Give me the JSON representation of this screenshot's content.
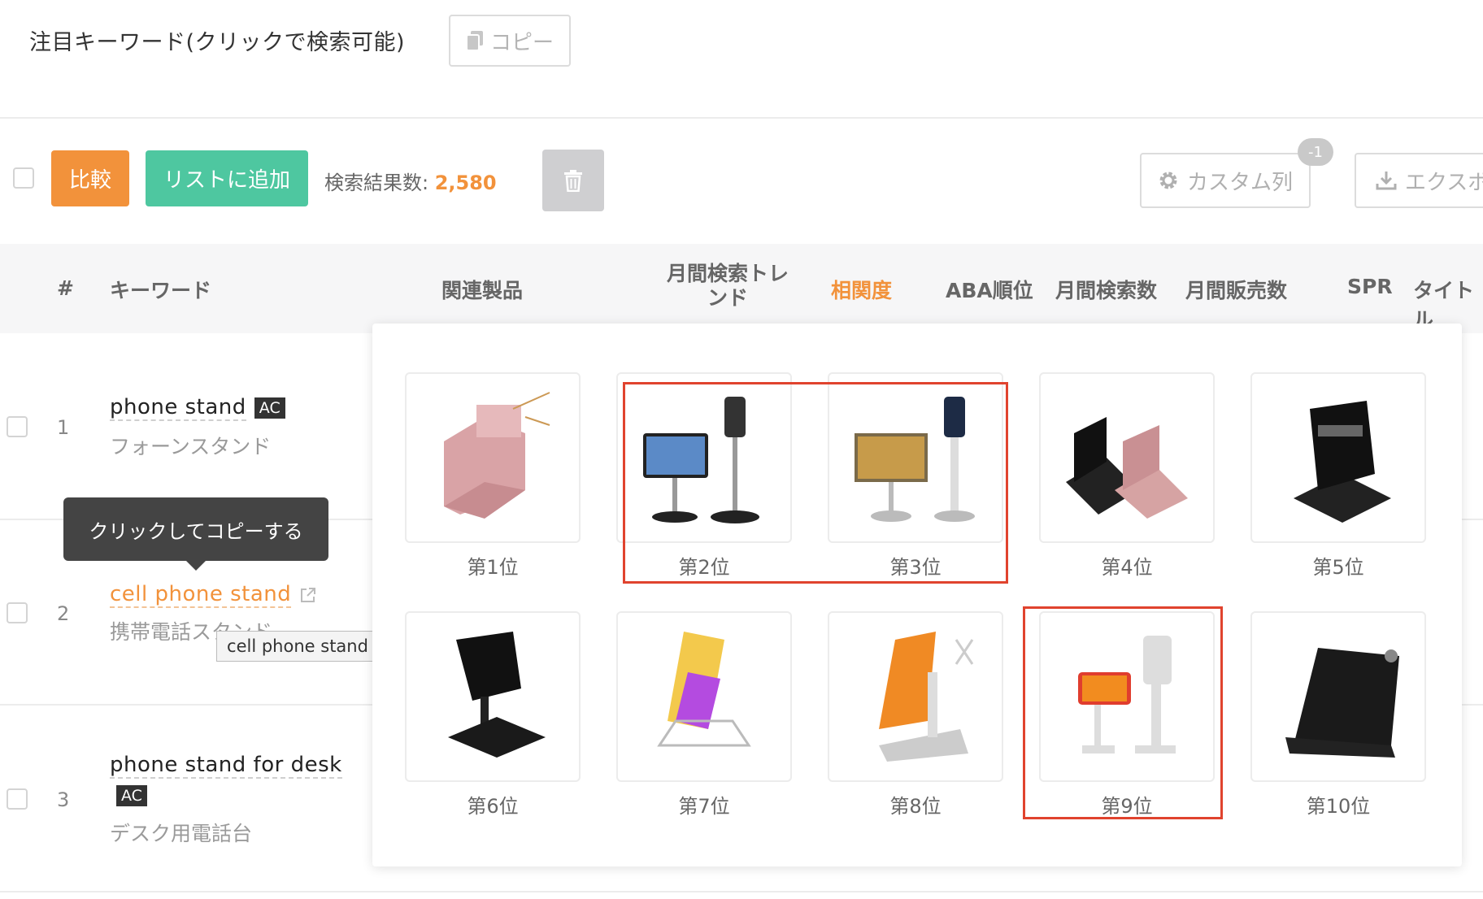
{
  "header": {
    "focus_keywords_title": "注目キーワード(クリックで検索可能)",
    "copy_button": "コピー"
  },
  "toolbar": {
    "compare_button": "比較",
    "add_to_list_button": "リストに追加",
    "result_label": "検索結果数: ",
    "result_count": "2,580",
    "custom_columns_button": "カスタム列",
    "custom_columns_badge": "-1",
    "export_button": "エクスポ"
  },
  "table": {
    "headers": {
      "index": "#",
      "keyword": "キーワード",
      "related_products": "関連製品",
      "monthly_search_trend": "月間検索トレンド",
      "relevance": "相関度",
      "aba_rank": "ABA順位",
      "monthly_searches": "月間検索数",
      "monthly_sales": "月間販売数",
      "spr": "SPR",
      "title": "タイトル"
    },
    "rows": [
      {
        "index": "1",
        "keyword": "phone stand",
        "badge": "AC",
        "translation": "フォーンスタンド"
      },
      {
        "index": "2",
        "keyword": "cell phone stand",
        "translation": "携帯電話スタンド"
      },
      {
        "index": "3",
        "keyword": "phone stand for desk",
        "badge": "AC",
        "translation": "デスク用電話台"
      }
    ]
  },
  "tooltips": {
    "copy_hint": "クリックしてコピーする",
    "full_keyword": "cell phone stand"
  },
  "popup": {
    "ranks": [
      "第1位",
      "第2位",
      "第3位",
      "第4位",
      "第5位",
      "第6位",
      "第7位",
      "第8位",
      "第9位",
      "第10位"
    ]
  },
  "colors": {
    "accent_orange": "#f2923b",
    "accent_green": "#4ec7a0",
    "highlight_red": "#e0432e"
  }
}
